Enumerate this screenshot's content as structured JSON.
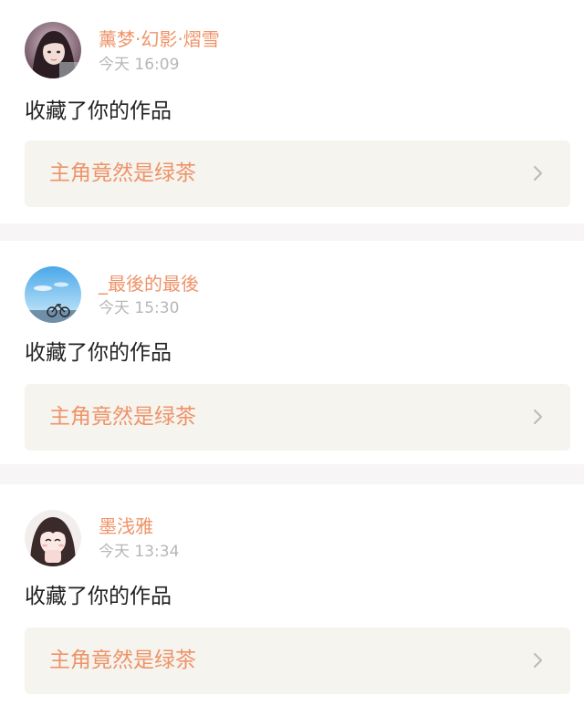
{
  "notifications": [
    {
      "username": "薰梦·幻影·熠雪",
      "time": "今天 16:09",
      "action": "收藏了你的作品",
      "work_title": "主角竟然是绿茶",
      "avatar_icon": "user-avatar-photo"
    },
    {
      "username": "_最後的最後",
      "time": "今天 15:30",
      "action": "收藏了你的作品",
      "work_title": "主角竟然是绿茶",
      "avatar_icon": "user-avatar-sky-bicycle"
    },
    {
      "username": "墨浅雅",
      "time": "今天 13:34",
      "action": "收藏了你的作品",
      "work_title": "主角竟然是绿茶",
      "avatar_icon": "user-avatar-anime-girl"
    }
  ],
  "colors": {
    "username": "#ef9368",
    "work_title": "#ef9368",
    "time": "#b7b7b7",
    "action": "#222222",
    "work_card_bg": "#f5f4ef",
    "divider_bg": "#f7f5f5"
  }
}
